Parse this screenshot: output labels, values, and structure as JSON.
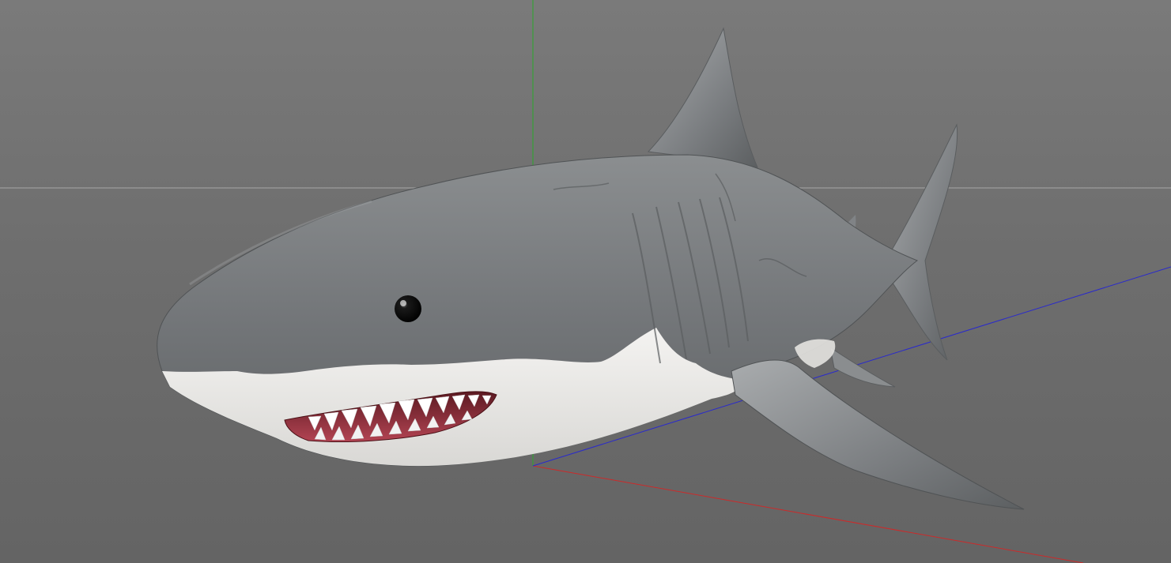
{
  "viewport": {
    "background_top": "#7a7a7a",
    "background_bottom": "#646464",
    "grid_line_color": "#a8a8a8"
  },
  "axes": {
    "x_axis_color": "#cc2a2a",
    "y_axis_color": "#2aa82a",
    "z_axis_color": "#2a2acc"
  },
  "model": {
    "name": "",
    "body_color": "#7c7f81",
    "belly_color": "#ecebe8",
    "eye_color": "#050505",
    "mouth_color": "#8a1f2b",
    "teeth_color": "#ffffff"
  }
}
